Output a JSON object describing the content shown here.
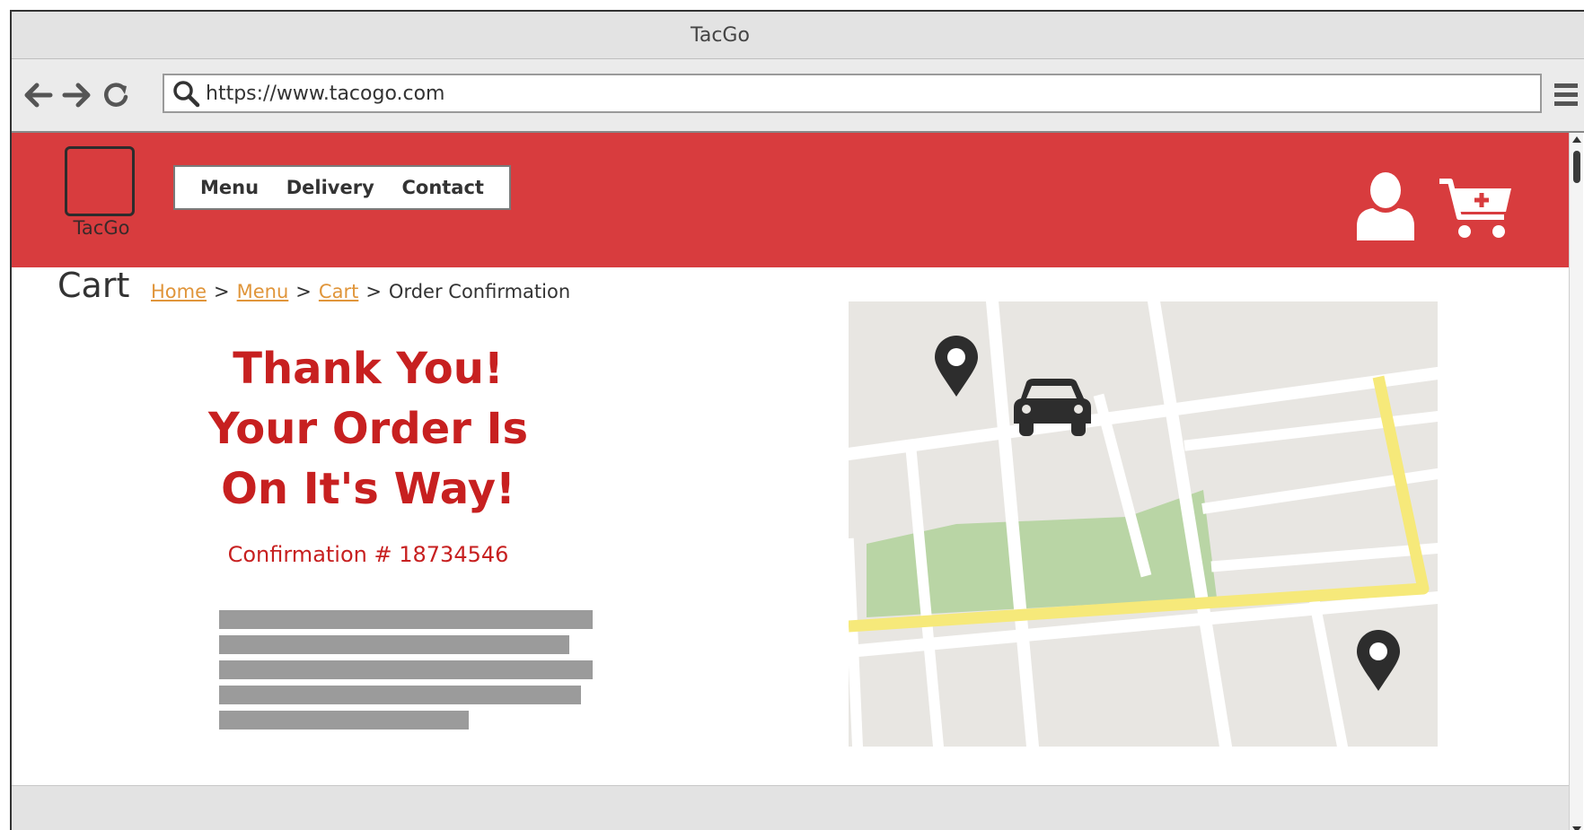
{
  "window": {
    "title": "TacGo"
  },
  "browser": {
    "url": "https://www.tacogo.com",
    "icons": {
      "back": "arrow-left-icon",
      "forward": "arrow-right-icon",
      "reload": "reload-icon",
      "search": "search-icon",
      "menu": "hamburger-menu-icon"
    }
  },
  "site": {
    "logo_text": "TacGo",
    "nav": [
      {
        "label": "Menu"
      },
      {
        "label": "Delivery"
      },
      {
        "label": "Contact"
      }
    ],
    "header_color": "#d83c3e",
    "icons": {
      "account": "user-icon",
      "cart": "shopping-cart-add-icon"
    }
  },
  "page": {
    "title": "Cart",
    "breadcrumb": {
      "links": [
        "Home",
        "Menu",
        "Cart"
      ],
      "current": "Order Confirmation",
      "separator": ">"
    },
    "thank_you_lines": [
      "Thank You!",
      "Your Order Is",
      "On It's Way!"
    ],
    "confirmation": "Confirmation # 18734546",
    "accent_color": "#c72020",
    "link_color": "#e0953a"
  },
  "map": {
    "icons": {
      "origin": "map-pin-icon",
      "destination": "map-pin-icon",
      "vehicle": "car-icon"
    },
    "route_color": "#f6e97a",
    "park_color": "#b9d5a5"
  }
}
